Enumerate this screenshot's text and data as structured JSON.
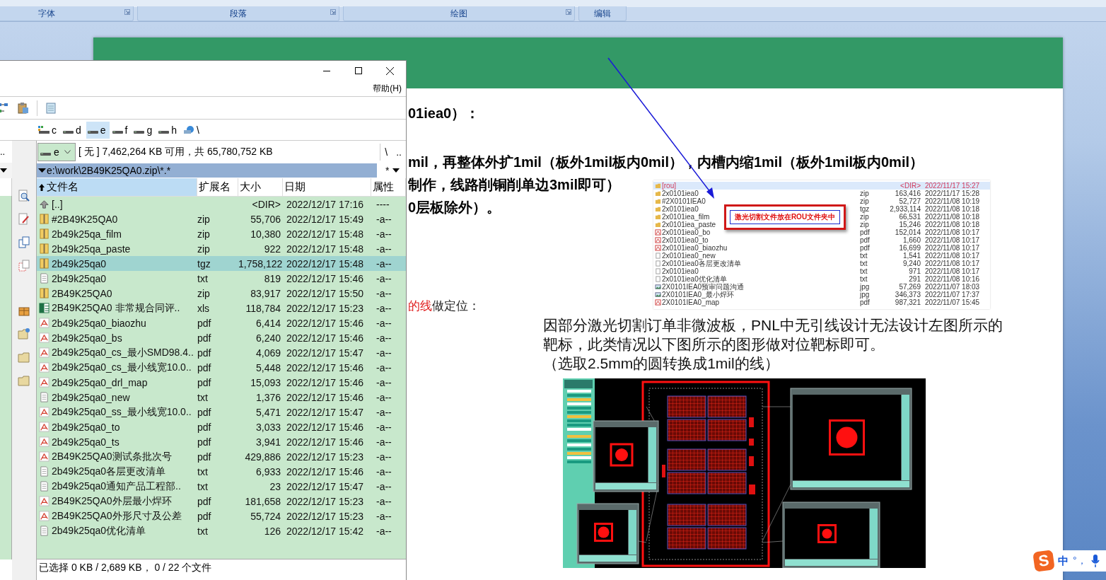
{
  "ribbon": {
    "groups": [
      {
        "label": "字体",
        "launcher": true
      },
      {
        "label": "段落",
        "launcher": true
      },
      {
        "label": "绘图",
        "launcher": true
      },
      {
        "label": "编辑",
        "launcher": false
      }
    ]
  },
  "document": {
    "heading_line": "01iea0）：",
    "rule_lines": [
      "mil，再整体外扩1mil（板外1mil板内0mil），内槽内缩1mil（板外1mil板内0mil）",
      "制作，线路削铜削单边3mil即可）",
      "0层板除外）。"
    ],
    "positioning_note": {
      "highlight": "的线",
      "text": "做定位："
    },
    "embedded_listing": {
      "callout": "激光切割文件放在ROU文件夹中",
      "rows": [
        {
          "kind": "folder",
          "name": "[rou]",
          "size": "<DIR>",
          "date": "2022/11/17 15:27",
          "selected": true
        },
        {
          "kind": "zip",
          "name": "2x0101iea0",
          "ext": "zip",
          "size": "163,416",
          "date": "2022/11/17 15:28",
          "selected": false
        },
        {
          "kind": "zip",
          "name": "#2X0101IEA0",
          "ext": "zip",
          "size": "52,727",
          "date": "2022/11/08 10:19",
          "selected": false
        },
        {
          "kind": "zip",
          "name": "2x0101iea0",
          "ext": "tgz",
          "size": "2,933,114",
          "date": "2022/11/08 10:18",
          "selected": false
        },
        {
          "kind": "zip",
          "name": "2x0101iea_film",
          "ext": "zip",
          "size": "66,531",
          "date": "2022/11/08 10:18",
          "selected": false
        },
        {
          "kind": "zip",
          "name": "2x0101iea_paste",
          "ext": "zip",
          "size": "15,246",
          "date": "2022/11/08 10:18",
          "selected": false
        },
        {
          "kind": "pdf",
          "name": "2x0101iea0_bo",
          "ext": "pdf",
          "size": "152,014",
          "date": "2022/11/08 10:17",
          "selected": false
        },
        {
          "kind": "pdf",
          "name": "2x0101iea0_to",
          "ext": "pdf",
          "size": "1,660",
          "date": "2022/11/08 10:17",
          "selected": false
        },
        {
          "kind": "pdf",
          "name": "2x0101iea0_biaozhu",
          "ext": "pdf",
          "size": "16,699",
          "date": "2022/11/08 10:17",
          "selected": false
        },
        {
          "kind": "txt",
          "name": "2x0101iea0_new",
          "ext": "txt",
          "size": "1,541",
          "date": "2022/11/08 10:17",
          "selected": false
        },
        {
          "kind": "txt",
          "name": "2x0101iea0各层更改清单",
          "ext": "txt",
          "size": "9,240",
          "date": "2022/11/08 10:17",
          "selected": false
        },
        {
          "kind": "txt",
          "name": "2x0101iea0",
          "ext": "txt",
          "size": "971",
          "date": "2022/11/08 10:17",
          "selected": false
        },
        {
          "kind": "txt",
          "name": "2x0101iea0优化清单",
          "ext": "txt",
          "size": "291",
          "date": "2022/11/08 10:16",
          "selected": false
        },
        {
          "kind": "jpg",
          "name": "2X0101IEA0预审问题沟通",
          "ext": "jpg",
          "size": "57,269",
          "date": "2022/11/07 18:03",
          "selected": false
        },
        {
          "kind": "jpg",
          "name": "2X0101IEA0_最小焊环",
          "ext": "jpg",
          "size": "346,373",
          "date": "2022/11/07 17:37",
          "selected": false
        },
        {
          "kind": "pdf",
          "name": "2X0101IEA0_map",
          "ext": "pdf",
          "size": "987,321",
          "date": "2022/11/07 15:45",
          "selected": false
        }
      ]
    },
    "paragraph": [
      "因部分激光切割订单非微波板，PNL中无引线设计无法设计左图所示的靶标，此类情况以下图所示的图形做对位靶标即可。",
      "（选取2.5mm的圆转换成1mil的线）"
    ]
  },
  "file_manager": {
    "menu": "帮助(H)",
    "drives": [
      {
        "label": "c",
        "kind": "system",
        "selected": false
      },
      {
        "label": "d",
        "kind": "drive",
        "selected": false
      },
      {
        "label": "e",
        "kind": "drive",
        "selected": true
      },
      {
        "label": "f",
        "kind": "drive",
        "selected": false
      },
      {
        "label": "g",
        "kind": "drive",
        "selected": false
      },
      {
        "label": "h",
        "kind": "drive",
        "selected": false
      },
      {
        "label": "\\",
        "kind": "network",
        "selected": false
      }
    ],
    "left_panel": {
      "parent": ".."
    },
    "drive_combo": "e",
    "disk_space": "[ 无 ]  7,462,264 KB 可用，共 65,780,752 KB",
    "root_button": "\\",
    "parent_button": "..",
    "path": "e:\\work\\2B49K25QA0.zip\\*.*",
    "filter": "*",
    "columns": [
      {
        "label": "文件名",
        "sorted": true
      },
      {
        "label": "扩展名",
        "sorted": false
      },
      {
        "label": "大小",
        "sorted": false
      },
      {
        "label": "日期",
        "sorted": false
      },
      {
        "label": "属性",
        "sorted": false
      }
    ],
    "rows": [
      {
        "kind": "up",
        "name": "[..]",
        "size": "<DIR>",
        "date": "2022/12/17 17:16",
        "attr": "----",
        "selected": false
      },
      {
        "kind": "zip",
        "name": "#2B49K25QA0",
        "ext": "zip",
        "size": "55,706",
        "date": "2022/12/17 15:49",
        "attr": "-a--",
        "selected": false
      },
      {
        "kind": "zip",
        "name": "2b49k25qa_film",
        "ext": "zip",
        "size": "10,380",
        "date": "2022/12/17 15:48",
        "attr": "-a--",
        "selected": false
      },
      {
        "kind": "zip",
        "name": "2b49k25qa_paste",
        "ext": "zip",
        "size": "922",
        "date": "2022/12/17 15:48",
        "attr": "-a--",
        "selected": false
      },
      {
        "kind": "zip",
        "name": "2b49k25qa0",
        "ext": "tgz",
        "size": "1,758,122",
        "date": "2022/12/17 15:48",
        "attr": "-a--",
        "selected": true
      },
      {
        "kind": "txt",
        "name": "2b49k25qa0",
        "ext": "txt",
        "size": "819",
        "date": "2022/12/17 15:46",
        "attr": "-a--",
        "selected": false
      },
      {
        "kind": "zip",
        "name": "2B49K25QA0",
        "ext": "zip",
        "size": "83,917",
        "date": "2022/12/17 15:50",
        "attr": "-a--",
        "selected": false
      },
      {
        "kind": "xls",
        "name": "2B49K25QA0  非常规合同评..",
        "ext": "xls",
        "size": "118,784",
        "date": "2022/12/17 15:23",
        "attr": "-a--",
        "selected": false
      },
      {
        "kind": "pdf",
        "name": "2b49k25qa0_biaozhu",
        "ext": "pdf",
        "size": "6,414",
        "date": "2022/12/17 15:46",
        "attr": "-a--",
        "selected": false
      },
      {
        "kind": "pdf",
        "name": "2b49k25qa0_bs",
        "ext": "pdf",
        "size": "6,240",
        "date": "2022/12/17 15:46",
        "attr": "-a--",
        "selected": false
      },
      {
        "kind": "pdf",
        "name": "2b49k25qa0_cs_最小SMD98.4..",
        "ext": "pdf",
        "size": "4,069",
        "date": "2022/12/17 15:47",
        "attr": "-a--",
        "selected": false
      },
      {
        "kind": "pdf",
        "name": "2b49k25qa0_cs_最小线宽10.0..",
        "ext": "pdf",
        "size": "5,448",
        "date": "2022/12/17 15:46",
        "attr": "-a--",
        "selected": false
      },
      {
        "kind": "pdf",
        "name": "2b49k25qa0_drl_map",
        "ext": "pdf",
        "size": "15,093",
        "date": "2022/12/17 15:46",
        "attr": "-a--",
        "selected": false
      },
      {
        "kind": "txt",
        "name": "2b49k25qa0_new",
        "ext": "txt",
        "size": "1,376",
        "date": "2022/12/17 15:46",
        "attr": "-a--",
        "selected": false
      },
      {
        "kind": "pdf",
        "name": "2b49k25qa0_ss_最小线宽10.0..",
        "ext": "pdf",
        "size": "5,471",
        "date": "2022/12/17 15:47",
        "attr": "-a--",
        "selected": false
      },
      {
        "kind": "pdf",
        "name": "2b49k25qa0_to",
        "ext": "pdf",
        "size": "3,033",
        "date": "2022/12/17 15:46",
        "attr": "-a--",
        "selected": false
      },
      {
        "kind": "pdf",
        "name": "2b49k25qa0_ts",
        "ext": "pdf",
        "size": "3,941",
        "date": "2022/12/17 15:46",
        "attr": "-a--",
        "selected": false
      },
      {
        "kind": "pdf",
        "name": "2B49K25QA0测试条批次号",
        "ext": "pdf",
        "size": "429,886",
        "date": "2022/12/17 15:23",
        "attr": "-a--",
        "selected": false
      },
      {
        "kind": "txt",
        "name": "2b49k25qa0各层更改清单",
        "ext": "txt",
        "size": "6,933",
        "date": "2022/12/17 15:46",
        "attr": "-a--",
        "selected": false
      },
      {
        "kind": "txt",
        "name": "2b49k25qa0通知产品工程部..",
        "ext": "txt",
        "size": "23",
        "date": "2022/12/17 15:47",
        "attr": "-a--",
        "selected": false
      },
      {
        "kind": "pdf",
        "name": "2B49K25QA0外层最小焊环",
        "ext": "pdf",
        "size": "181,658",
        "date": "2022/12/17 15:23",
        "attr": "-a--",
        "selected": false
      },
      {
        "kind": "pdf",
        "name": "2B49K25QA0外形尺寸及公差",
        "ext": "pdf",
        "size": "55,724",
        "date": "2022/12/17 15:23",
        "attr": "-a--",
        "selected": false
      },
      {
        "kind": "txt",
        "name": "2b49k25qa0优化清单",
        "ext": "txt",
        "size": "126",
        "date": "2022/12/17 15:42",
        "attr": "-a--",
        "selected": false
      }
    ],
    "status": "已选择 0 KB / 2,689 KB， 0 / 22 个文件"
  },
  "ime": {
    "logo": "S",
    "mode": "中",
    "punctuation": "°，"
  }
}
